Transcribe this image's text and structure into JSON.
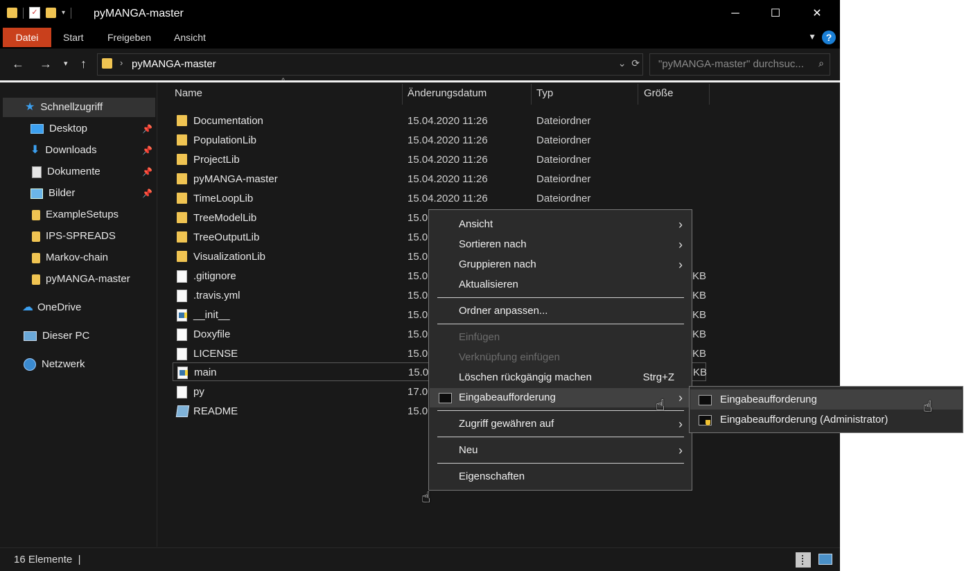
{
  "window": {
    "title": "pyMANGA-master",
    "controls": {
      "minimize": "─",
      "maximize": "☐",
      "close": "✕"
    }
  },
  "ribbon": {
    "tabs": [
      "Datei",
      "Start",
      "Freigeben",
      "Ansicht"
    ],
    "help": "?"
  },
  "address": {
    "path": "pyMANGA-master",
    "search_placeholder": "\"pyMANGA-master\" durchsuc..."
  },
  "nav": {
    "items": [
      {
        "label": "Schnellzugriff",
        "icon": "star-icon"
      },
      {
        "label": "Desktop",
        "icon": "desktop-icon",
        "pinned": true
      },
      {
        "label": "Downloads",
        "icon": "download-icon",
        "pinned": true
      },
      {
        "label": "Dokumente",
        "icon": "document-icon",
        "pinned": true
      },
      {
        "label": "Bilder",
        "icon": "pictures-icon",
        "pinned": true
      },
      {
        "label": "ExampleSetups",
        "icon": "folder-icon"
      },
      {
        "label": "IPS-SPREADS",
        "icon": "folder-icon"
      },
      {
        "label": "Markov-chain",
        "icon": "folder-icon"
      },
      {
        "label": "pyMANGA-master",
        "icon": "folder-icon"
      },
      {
        "label": "OneDrive",
        "icon": "cloud-icon"
      },
      {
        "label": "Dieser PC",
        "icon": "computer-icon"
      },
      {
        "label": "Netzwerk",
        "icon": "network-icon"
      }
    ]
  },
  "list": {
    "columns": {
      "name": "Name",
      "date": "Änderungsdatum",
      "type": "Typ",
      "size": "Größe"
    },
    "rows": [
      {
        "name": "Documentation",
        "date": "15.04.2020 11:26",
        "type": "Dateiordner",
        "size": "",
        "icon": "folder-icon"
      },
      {
        "name": "PopulationLib",
        "date": "15.04.2020 11:26",
        "type": "Dateiordner",
        "size": "",
        "icon": "folder-icon"
      },
      {
        "name": "ProjectLib",
        "date": "15.04.2020 11:26",
        "type": "Dateiordner",
        "size": "",
        "icon": "folder-icon"
      },
      {
        "name": "pyMANGA-master",
        "date": "15.04.2020 11:26",
        "type": "Dateiordner",
        "size": "",
        "icon": "folder-icon"
      },
      {
        "name": "TimeLoopLib",
        "date": "15.04.2020 11:26",
        "type": "Dateiordner",
        "size": "",
        "icon": "folder-icon"
      },
      {
        "name": "TreeModelLib",
        "date": "15.0",
        "type": "",
        "size": "",
        "icon": "folder-icon"
      },
      {
        "name": "TreeOutputLib",
        "date": "15.0",
        "type": "",
        "size": "",
        "icon": "folder-icon"
      },
      {
        "name": "VisualizationLib",
        "date": "15.0",
        "type": "",
        "size": "",
        "icon": "folder-icon"
      },
      {
        "name": ".gitignore",
        "date": "15.0",
        "type": "",
        "size": "KB",
        "icon": "file-icon"
      },
      {
        "name": ".travis.yml",
        "date": "15.0",
        "type": "",
        "size": "KB",
        "icon": "file-icon"
      },
      {
        "name": "__init__",
        "date": "15.0",
        "type": "",
        "size": "KB",
        "icon": "python-file-icon"
      },
      {
        "name": "Doxyfile",
        "date": "15.0",
        "type": "",
        "size": "KB",
        "icon": "file-icon"
      },
      {
        "name": "LICENSE",
        "date": "15.0",
        "type": "",
        "size": "KB",
        "icon": "file-icon"
      },
      {
        "name": "main",
        "date": "15.0",
        "type": "",
        "size": "KB",
        "icon": "python-file-icon"
      },
      {
        "name": "py",
        "date": "17.0",
        "type": "",
        "size": "",
        "icon": "file-icon"
      },
      {
        "name": "README",
        "date": "15.0",
        "type": "",
        "size": "",
        "icon": "readme-icon"
      }
    ]
  },
  "status": {
    "count": "16 Elemente"
  },
  "context_menu": {
    "items": [
      {
        "label": "Ansicht",
        "submenu": true
      },
      {
        "label": "Sortieren nach",
        "submenu": true
      },
      {
        "label": "Gruppieren nach",
        "submenu": true
      },
      {
        "label": "Aktualisieren"
      },
      {
        "label": "Ordner anpassen..."
      },
      {
        "label": "Einfügen",
        "disabled": true
      },
      {
        "label": "Verknüpfung einfügen",
        "disabled": true
      },
      {
        "label": "Löschen rückgängig machen",
        "shortcut": "Strg+Z"
      },
      {
        "label": "Eingabeaufforderung",
        "submenu": true,
        "icon": "cmd-icon"
      },
      {
        "label": "Zugriff gewähren auf",
        "submenu": true
      },
      {
        "label": "Neu",
        "submenu": true
      },
      {
        "label": "Eigenschaften"
      }
    ]
  },
  "submenu": {
    "items": [
      {
        "label": "Eingabeaufforderung",
        "icon": "cmd-icon"
      },
      {
        "label": "Eingabeaufforderung (Administrator)",
        "icon": "cmd-admin-icon"
      }
    ]
  },
  "colors": {
    "accent_file_tab": "#c9401c",
    "background": "#191919",
    "menu_bg": "#2b2b2b"
  }
}
